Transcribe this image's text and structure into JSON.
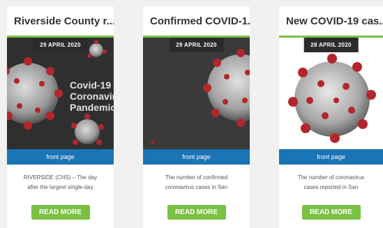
{
  "cards": [
    {
      "title": "Riverside County r...",
      "date": "29 APRIL 2020",
      "image_text_1": "Covid-19",
      "image_text_2": "Coronavir",
      "image_text_3": "Pandemic",
      "category": "front page",
      "excerpt_line_1": "RIVERSIDE (CNS) – The day",
      "excerpt_line_2": "after the largest single-day",
      "button": "READ MORE"
    },
    {
      "title": "Confirmed COVID-1...",
      "date": "29 APRIL 2020",
      "category": "front page",
      "excerpt_line_1": "The number of confirmed",
      "excerpt_line_2": "coronavirus cases in San",
      "button": "READ MORE"
    },
    {
      "title": "New COVID-19 cas...",
      "date": "28 APRIL 2020",
      "category": "front page",
      "excerpt_line_1": "The number of coronavirus",
      "excerpt_line_2": "cases reported in San",
      "button": "READ MORE"
    }
  ],
  "colors": {
    "accent_green": "#7ac143",
    "category_blue": "#1a74b6",
    "badge_dark": "#2b2b2b",
    "virus_red": "#b3262b"
  },
  "icons": [
    "coronavirus-image"
  ]
}
